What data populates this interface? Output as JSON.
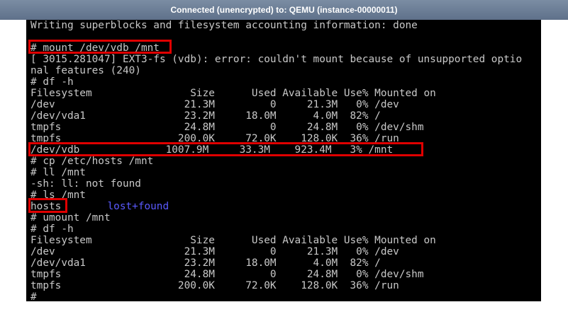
{
  "window": {
    "title": "Connected (unencrypted) to: QEMU (instance-00000011)"
  },
  "terminal": {
    "lines": [
      "Writing superblocks and filesystem accounting information: done",
      "",
      "# mount /dev/vdb /mnt",
      "[ 3015.281047] EXT3-fs (vdb): error: couldn't mount because of unsupported optio",
      "nal features (240)",
      "# df -h",
      "Filesystem                Size      Used Available Use% Mounted on",
      "/dev                     21.3M         0     21.3M   0% /dev",
      "/dev/vda1                23.2M     18.0M      4.0M  82% /",
      "tmpfs                    24.8M         0     24.8M   0% /dev/shm",
      "tmpfs                   200.0K     72.0K    128.0K  36% /run",
      "/dev/vdb              1007.9M     33.3M    923.4M   3% /mnt",
      "# cp /etc/hosts /mnt",
      "# ll /mnt",
      "-sh: ll: not found",
      "# ls /mnt",
      "hosts",
      "# umount /mnt",
      "# df -h",
      "Filesystem                Size      Used Available Use% Mounted on",
      "/dev                     21.3M         0     21.3M   0% /dev",
      "/dev/vda1                23.2M     18.0M      4.0M  82% /",
      "tmpfs                    24.8M         0     24.8M   0% /dev/shm",
      "tmpfs                   200.0K     72.0K    128.0K  36% /run",
      "# "
    ],
    "ls_dir_entry": "lost+found",
    "cursor_char": "_"
  },
  "colors": {
    "terminal_bg": "#000000",
    "terminal_text": "#c8c8c8",
    "directory_text": "#5a5aff",
    "annotation_border": "#e00000",
    "titlebar_bg": "#6b7d95"
  }
}
